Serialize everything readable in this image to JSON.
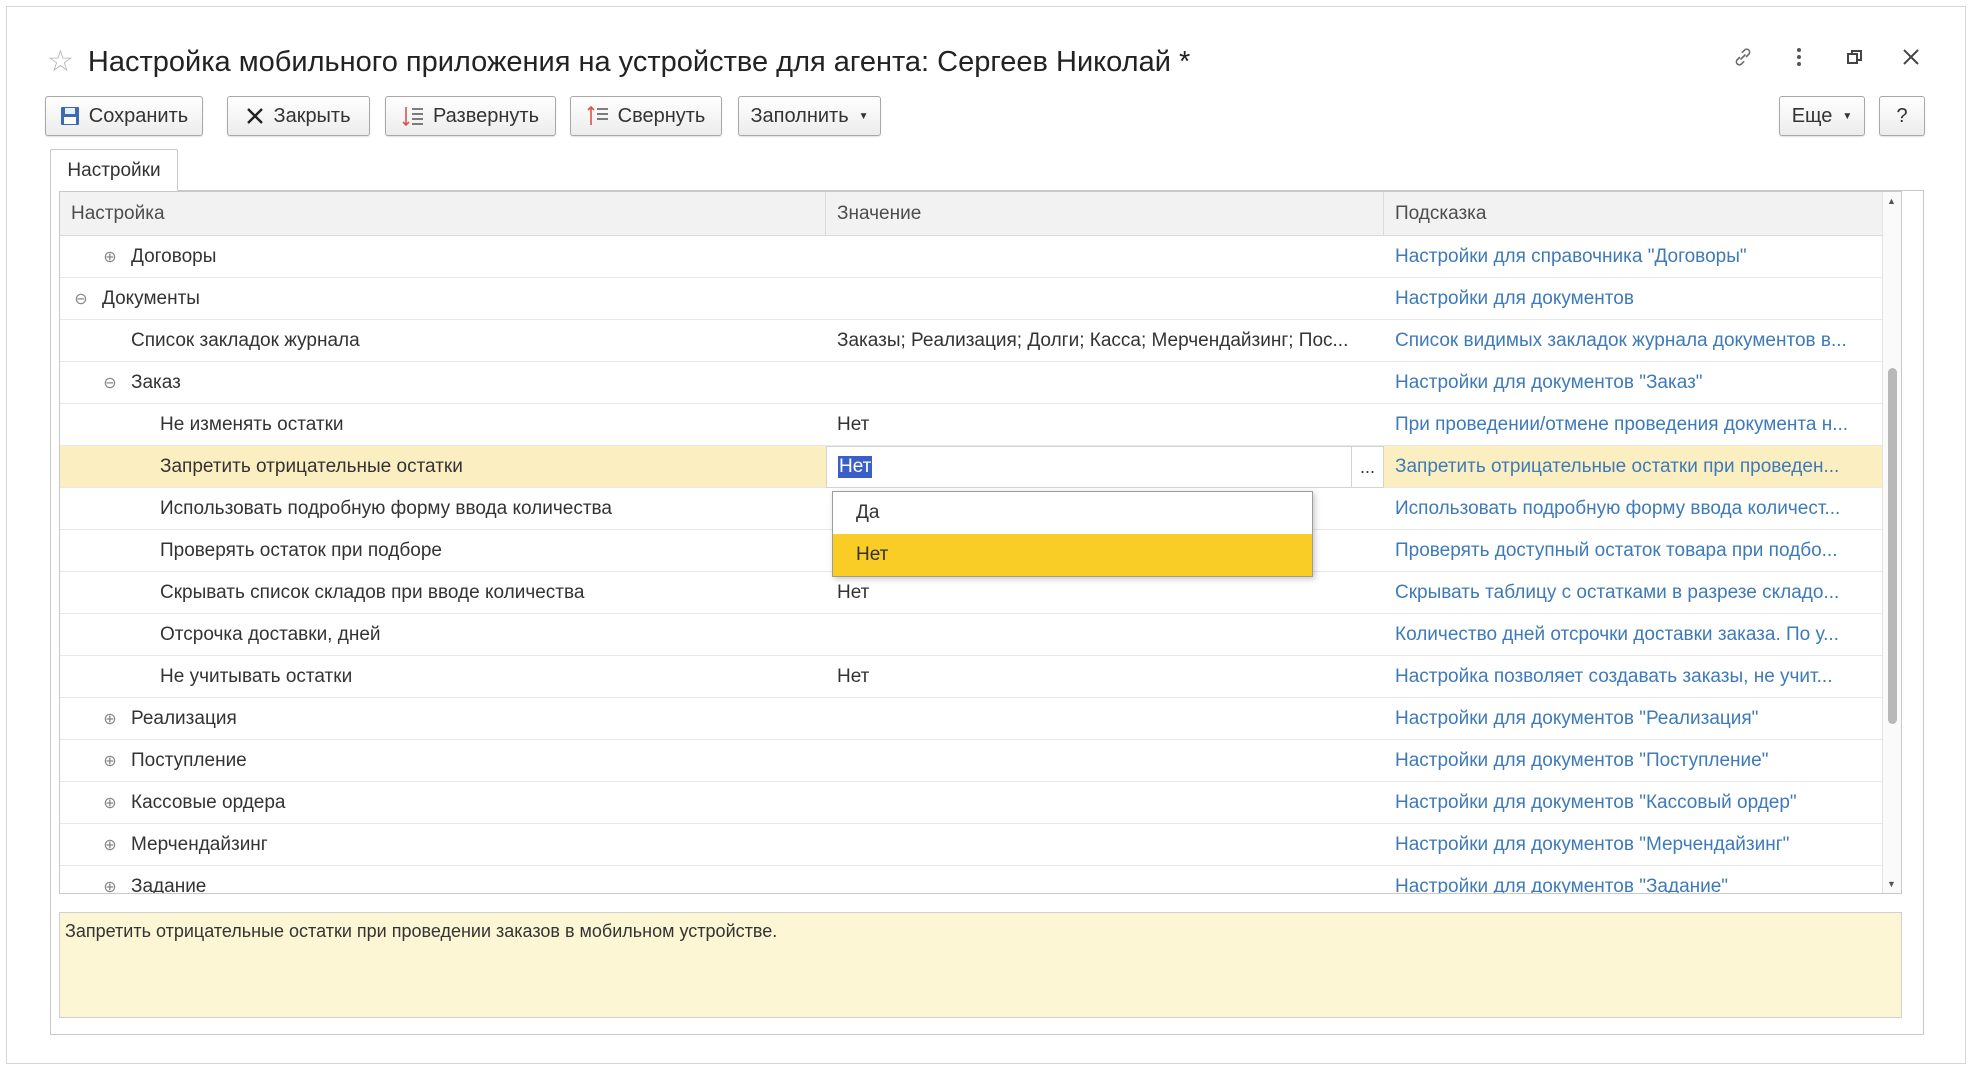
{
  "window": {
    "title": "Настройка мобильного приложения на устройстве для агента: Сергеев Николай *",
    "icons": [
      "star-icon",
      "link-icon",
      "more-icon",
      "restore-icon",
      "close-icon"
    ]
  },
  "toolbar": {
    "save_label": "Сохранить",
    "close_label": "Закрыть",
    "expand_label": "Развернуть",
    "collapse_label": "Свернуть",
    "fill_label": "Заполнить",
    "more_label": "Еще",
    "help_label": "?"
  },
  "tabs": [
    {
      "label": "Настройки"
    }
  ],
  "table": {
    "columns": [
      "Настройка",
      "Значение",
      "Подсказка"
    ],
    "rows": [
      {
        "name": "Договоры",
        "value": "",
        "hint": "Настройки для справочника \"Договоры\""
      },
      {
        "name": "Документы",
        "value": "",
        "hint": "Настройки для документов"
      },
      {
        "name": "Список закладок журнала",
        "value": "Заказы; Реализация; Долги; Касса; Мерчендайзинг; Пос...",
        "hint": "Список видимых закладок журнала документов в..."
      },
      {
        "name": "Заказ",
        "value": "",
        "hint": "Настройки для документов \"Заказ\""
      },
      {
        "name": "Не изменять остатки",
        "value": "Нет",
        "hint": "При проведении/отмене проведения документа н..."
      },
      {
        "name": "Запретить отрицательные остатки",
        "value": "Нет",
        "hint": "Запретить отрицательные остатки при проведен..."
      },
      {
        "name": "Использовать подробную форму ввода количества",
        "value": "",
        "hint": "Использовать подробную форму ввода количест..."
      },
      {
        "name": "Проверять остаток при подборе",
        "value": "",
        "hint": "Проверять доступный остаток товара при подбо..."
      },
      {
        "name": "Скрывать список складов при вводе количества",
        "value": "Нет",
        "hint": "Скрывать таблицу с остатками в разрезе складо..."
      },
      {
        "name": "Отсрочка доставки, дней",
        "value": "",
        "hint": "Количество дней отсрочки доставки заказа. По у..."
      },
      {
        "name": "Не учитывать остатки",
        "value": "Нет",
        "hint": "Настройка позволяет создавать заказы, не учит..."
      },
      {
        "name": "Реализация",
        "value": "",
        "hint": "Настройки для документов \"Реализация\""
      },
      {
        "name": "Поступление",
        "value": "",
        "hint": "Настройки для документов \"Поступление\""
      },
      {
        "name": "Кассовые ордера",
        "value": "",
        "hint": "Настройки для документов \"Кассовый ордер\""
      },
      {
        "name": "Мерчендайзинг",
        "value": "",
        "hint": "Настройки для документов \"Мерчендайзинг\""
      },
      {
        "name": "Задание",
        "value": "",
        "hint": "Настройки для документов \"Задание\""
      }
    ],
    "edit_button": "..."
  },
  "dropdown": {
    "options": [
      "Да",
      "Нет"
    ],
    "selected": "Нет"
  },
  "hint_text": "Запретить отрицательные остатки при проведении заказов в мобильном устройстве.",
  "colors": {
    "selected_row": "#fbefc1",
    "dropdown_active": "#f9cc26",
    "hint_link": "#3e7ab8",
    "hint_box": "#fcf6d4"
  }
}
